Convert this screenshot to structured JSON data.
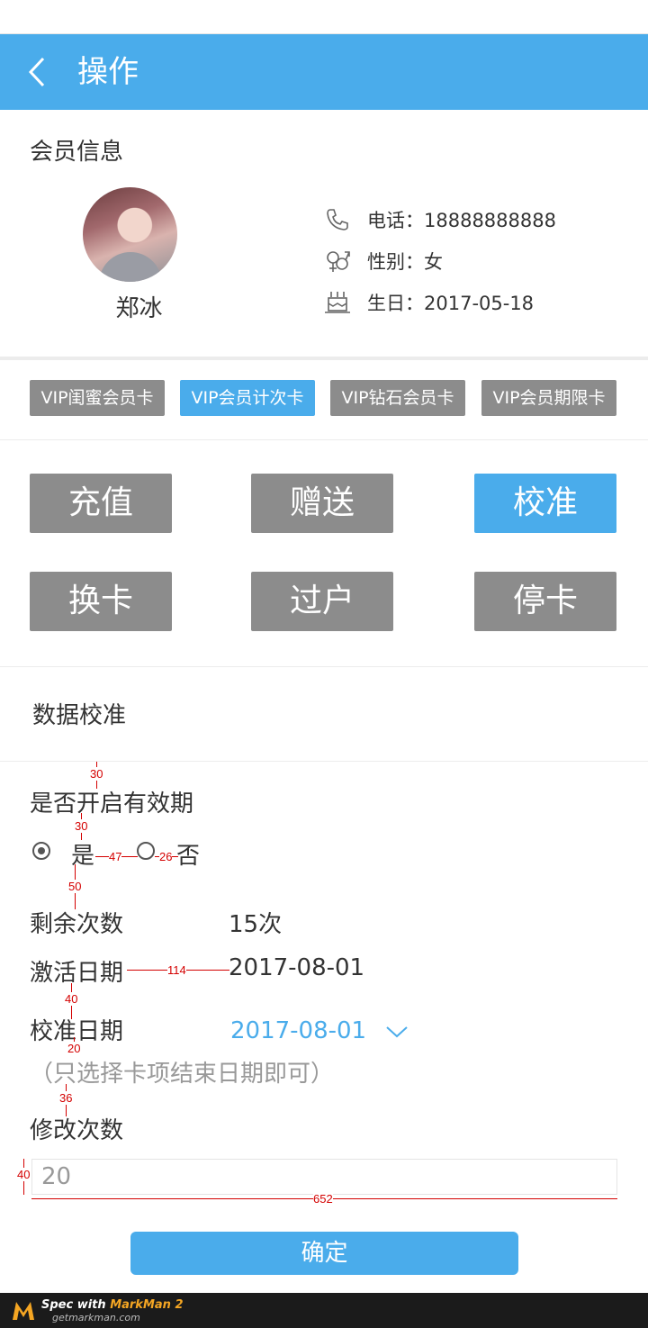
{
  "header": {
    "title": "操作"
  },
  "member": {
    "section_label": "会员信息",
    "name": "郑冰",
    "phone": "电话：18888888888",
    "gender": "性别：女",
    "birthday": "生日：2017-05-18"
  },
  "card_tabs": [
    {
      "label": "VIP闺蜜会员卡",
      "active": false
    },
    {
      "label": "VIP会员计次卡",
      "active": true
    },
    {
      "label": "VIP钻石会员卡",
      "active": false
    },
    {
      "label": "VIP会员期限卡",
      "active": false
    }
  ],
  "operations": [
    {
      "label": "充值",
      "active": false
    },
    {
      "label": "赠送",
      "active": false
    },
    {
      "label": "校准",
      "active": true
    },
    {
      "label": "换卡",
      "active": false
    },
    {
      "label": "过户",
      "active": false
    },
    {
      "label": "停卡",
      "active": false
    }
  ],
  "calibration": {
    "section_title": "数据校准",
    "validity_label": "是否开启有效期",
    "option_yes": "是",
    "option_no": "否",
    "selected": "是",
    "remaining_label": "剩余次数",
    "remaining_value": "15次",
    "activation_label": "激活日期",
    "activation_value": "2017-08-01",
    "calib_date_label": "校准日期",
    "calib_date_value": "2017-08-01",
    "hint": "（只选择卡项结束日期即可）",
    "modify_label": "修改次数",
    "modify_value": "20",
    "confirm_label": "确定"
  },
  "spec_marks": [
    "30",
    "30",
    "47",
    "26",
    "50",
    "114",
    "40",
    "20",
    "36",
    "40",
    "652"
  ],
  "footer": {
    "line1_prefix": "Spec with ",
    "line1_brand": "MarkMan 2",
    "line2": "getmarkman.com"
  },
  "colors": {
    "accent": "#4aaceb",
    "inactive": "#8c8c8c",
    "spec": "#d40000"
  }
}
